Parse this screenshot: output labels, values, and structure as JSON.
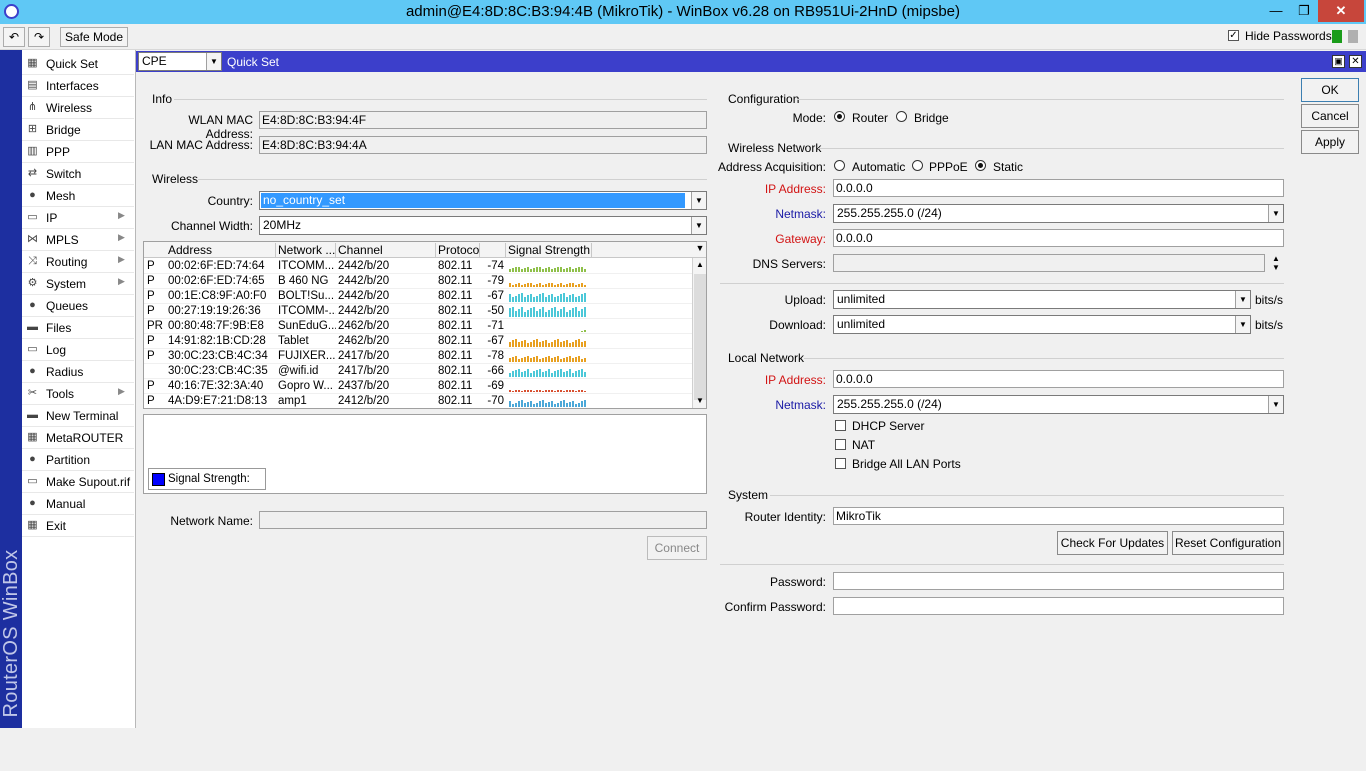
{
  "window": {
    "title": "admin@E4:8D:8C:B3:94:4B (MikroTik) - WinBox v6.28 on RB951Ui-2HnD (mipsbe)"
  },
  "toolbar": {
    "safe_mode": "Safe Mode",
    "hide_passwords": "Hide Passwords"
  },
  "brand": "RouterOS WinBox",
  "sidebar": {
    "items": [
      {
        "label": "Quick Set",
        "icon": "quickset-icon",
        "glyph": "▦",
        "sub": false
      },
      {
        "label": "Interfaces",
        "icon": "interfaces-icon",
        "glyph": "▤",
        "sub": false
      },
      {
        "label": "Wireless",
        "icon": "wireless-icon",
        "glyph": "⋔",
        "sub": false
      },
      {
        "label": "Bridge",
        "icon": "bridge-icon",
        "glyph": "⊞",
        "sub": false
      },
      {
        "label": "PPP",
        "icon": "ppp-icon",
        "glyph": "▥",
        "sub": false
      },
      {
        "label": "Switch",
        "icon": "switch-icon",
        "glyph": "⇄",
        "sub": false
      },
      {
        "label": "Mesh",
        "icon": "mesh-icon",
        "glyph": "●",
        "sub": false
      },
      {
        "label": "IP",
        "icon": "ip-icon",
        "glyph": "▭",
        "sub": true
      },
      {
        "label": "MPLS",
        "icon": "mpls-icon",
        "glyph": "⋈",
        "sub": true
      },
      {
        "label": "Routing",
        "icon": "routing-icon",
        "glyph": "⤨",
        "sub": true
      },
      {
        "label": "System",
        "icon": "system-icon",
        "glyph": "⚙",
        "sub": true
      },
      {
        "label": "Queues",
        "icon": "queues-icon",
        "glyph": "●",
        "sub": false
      },
      {
        "label": "Files",
        "icon": "files-icon",
        "glyph": "▬",
        "sub": false
      },
      {
        "label": "Log",
        "icon": "log-icon",
        "glyph": "▭",
        "sub": false
      },
      {
        "label": "Radius",
        "icon": "radius-icon",
        "glyph": "●",
        "sub": false
      },
      {
        "label": "Tools",
        "icon": "tools-icon",
        "glyph": "✂",
        "sub": true
      },
      {
        "label": "New Terminal",
        "icon": "terminal-icon",
        "glyph": "▬",
        "sub": false
      },
      {
        "label": "MetaROUTER",
        "icon": "metarouter-icon",
        "glyph": "▦",
        "sub": false
      },
      {
        "label": "Partition",
        "icon": "partition-icon",
        "glyph": "●",
        "sub": false
      },
      {
        "label": "Make Supout.rif",
        "icon": "supout-icon",
        "glyph": "▭",
        "sub": false
      },
      {
        "label": "Manual",
        "icon": "manual-icon",
        "glyph": "●",
        "sub": false
      },
      {
        "label": "Exit",
        "icon": "exit-icon",
        "glyph": "▦",
        "sub": false
      }
    ]
  },
  "quickset": {
    "mode_value": "CPE",
    "title": "Quick Set"
  },
  "info": {
    "section": "Info",
    "wlan_mac_label": "WLAN MAC Address:",
    "wlan_mac": "E4:8D:8C:B3:94:4F",
    "lan_mac_label": "LAN MAC Address:",
    "lan_mac": "E4:8D:8C:B3:94:4A"
  },
  "wireless": {
    "section": "Wireless",
    "country_label": "Country:",
    "country": "no_country_set",
    "channel_width_label": "Channel Width:",
    "channel_width": "20MHz"
  },
  "scan_table": {
    "columns": [
      "Address",
      "Network ...",
      "Channel",
      "Protocol",
      "",
      "Signal Strength"
    ],
    "rows": [
      {
        "flag": "P",
        "address": "00:02:6F:ED:74:64",
        "network": "ITCOMM...",
        "channel": "2442/b/20",
        "protocol": "802.11",
        "signal": "-74",
        "bars_strength": 0.45,
        "bar_color": "#8fc04a"
      },
      {
        "flag": "P",
        "address": "00:02:6F:ED:74:65",
        "network": "B 460 NG",
        "channel": "2442/b/20",
        "protocol": "802.11",
        "signal": "-79",
        "bars_strength": 0.35,
        "bar_color": "#e8a020"
      },
      {
        "flag": "P",
        "address": "00:1E:C8:9F:A0:F0",
        "network": "BOLT!Su...",
        "channel": "2442/b/20",
        "protocol": "802.11",
        "signal": "-67",
        "bars_strength": 0.75,
        "bar_color": "#4cc8d8"
      },
      {
        "flag": "P",
        "address": "00:27:19:19:26:36",
        "network": "ITCOMM-...",
        "channel": "2442/b/20",
        "protocol": "802.11",
        "signal": "-50",
        "bars_strength": 0.9,
        "bar_color": "#4cc8d8"
      },
      {
        "flag": "PR",
        "address": "00:80:48:7F:9B:E8",
        "network": "SunEduG...",
        "channel": "2462/b/20",
        "protocol": "802.11",
        "signal": "-71",
        "bars_strength": 0.15,
        "bar_color": "#8fc04a"
      },
      {
        "flag": "P",
        "address": "14:91:82:1B:CD:28",
        "network": "Tablet",
        "channel": "2462/b/20",
        "protocol": "802.11",
        "signal": "-67",
        "bars_strength": 0.65,
        "bar_color": "#e8a020"
      },
      {
        "flag": "P",
        "address": "30:0C:23:CB:4C:34",
        "network": "FUJIXER...",
        "channel": "2417/b/20",
        "protocol": "802.11",
        "signal": "-78",
        "bars_strength": 0.5,
        "bar_color": "#e8a020"
      },
      {
        "flag": "",
        "address": "30:0C:23:CB:4C:35",
        "network": "@wifi.id",
        "channel": "2417/b/20",
        "protocol": "802.11",
        "signal": "-66",
        "bars_strength": 0.7,
        "bar_color": "#4cc8d8"
      },
      {
        "flag": "P",
        "address": "40:16:7E:32:3A:40",
        "network": "Gopro W...",
        "channel": "2437/b/20",
        "protocol": "802.11",
        "signal": "-69",
        "bars_strength": 0.2,
        "bar_color": "#d85030"
      },
      {
        "flag": "P",
        "address": "4A:D9:E7:21:D8:13",
        "network": "amp1",
        "channel": "2412/b/20",
        "protocol": "802.11",
        "signal": "-70",
        "bars_strength": 0.55,
        "bar_color": "#4ca8d8"
      }
    ]
  },
  "graph": {
    "legend": "Signal Strength:"
  },
  "network_name": {
    "label": "Network Name:",
    "value": ""
  },
  "connect_label": "Connect",
  "configuration": {
    "section": "Configuration",
    "mode_label": "Mode:",
    "router": "Router",
    "bridge": "Bridge",
    "selected": "Router"
  },
  "wireless_network": {
    "section": "Wireless Network",
    "acq_label": "Address Acquisition:",
    "automatic": "Automatic",
    "pppoe": "PPPoE",
    "static": "Static",
    "ip_label": "IP Address:",
    "ip": "0.0.0.0",
    "netmask_label": "Netmask:",
    "netmask": "255.255.255.0 (/24)",
    "gateway_label": "Gateway:",
    "gateway": "0.0.0.0",
    "dns_label": "DNS Servers:",
    "dns": ""
  },
  "bandwidth": {
    "upload_label": "Upload:",
    "upload": "unlimited",
    "download_label": "Download:",
    "download": "unlimited",
    "unit": "bits/s"
  },
  "local_network": {
    "section": "Local Network",
    "ip_label": "IP Address:",
    "ip": "0.0.0.0",
    "netmask_label": "Netmask:",
    "netmask": "255.255.255.0 (/24)",
    "dhcp": "DHCP Server",
    "nat": "NAT",
    "bridge_all": "Bridge All LAN Ports"
  },
  "system": {
    "section": "System",
    "identity_label": "Router Identity:",
    "identity": "MikroTik",
    "check_updates": "Check For Updates",
    "reset": "Reset Configuration",
    "password_label": "Password:",
    "confirm_label": "Confirm Password:"
  },
  "buttons": {
    "ok": "OK",
    "cancel": "Cancel",
    "apply": "Apply"
  }
}
